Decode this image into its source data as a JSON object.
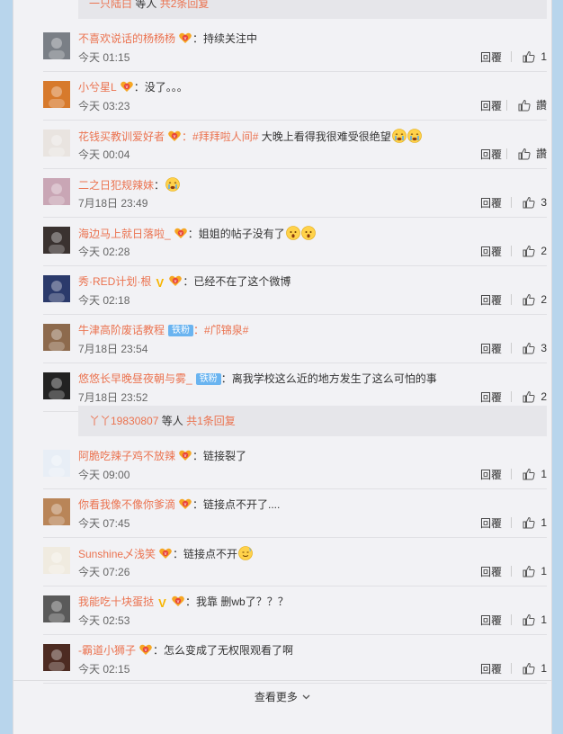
{
  "top_sub_bar": {
    "user": "一只陆白",
    "mid": " 等人 ",
    "count": "共2条回复"
  },
  "mid_sub_bar": {
    "user": "丫丫19830807",
    "mid": " 等人 ",
    "count": "共1条回复"
  },
  "reply_label": "回覆",
  "comments_group1": [
    {
      "user": "不喜欢说话的杨杨杨",
      "v": false,
      "tie": false,
      "text": "：持续关注中",
      "hashtag": "",
      "emoji": [],
      "time": "今天 01:15",
      "likes": "1"
    },
    {
      "user": "小兮星L",
      "v": false,
      "tie": false,
      "text": "：没了。。。",
      "hashtag": "",
      "emoji": [],
      "time": "今天 03:23",
      "likes": "讚"
    },
    {
      "user": "花钱买教训爱好者",
      "v": false,
      "tie": false,
      "text": " 大晚上看得我很难受很绝望",
      "hashtag": "：#拜拜啦人间#",
      "emoji": [
        "cry",
        "cry"
      ],
      "time": "今天 00:04",
      "likes": "讚"
    },
    {
      "user": "二之日犯规辣妹",
      "v": false,
      "tie": false,
      "text": "：",
      "hashtag": "",
      "emoji": [
        "cry"
      ],
      "time": "7月18日 23:49",
      "likes": "3",
      "nofan": true
    },
    {
      "user": "海边马上就日落啦_",
      "v": false,
      "tie": false,
      "text": "：姐姐的帖子没有了",
      "hashtag": "",
      "emoji": [
        "shock",
        "shock"
      ],
      "time": "今天 02:28",
      "likes": "2"
    },
    {
      "user": "秀·RED计划·根",
      "v": true,
      "tie": false,
      "text": "：已经不在了这个微博",
      "hashtag": "",
      "emoji": [],
      "time": "今天 02:18",
      "likes": "2"
    },
    {
      "user": "牛津高阶废话教程",
      "v": false,
      "tie": true,
      "text": "",
      "hashtag": "：#邝锦泉#",
      "emoji": [],
      "time": "7月18日 23:54",
      "likes": "3",
      "nofan": true
    },
    {
      "user": "悠悠长早晚昼夜朝与雾_",
      "v": false,
      "tie": true,
      "text": "：离我学校这么近的地方发生了这么可怕的事",
      "hashtag": "",
      "emoji": [],
      "time": "7月18日 23:52",
      "likes": "2",
      "nofan": true
    }
  ],
  "comments_group2": [
    {
      "user": "阿脆吃辣子鸡不放辣",
      "v": false,
      "tie": false,
      "text": "：链接裂了",
      "hashtag": "",
      "emoji": [],
      "time": "今天 09:00",
      "likes": "1"
    },
    {
      "user": "你看我像不像你爹滴",
      "v": false,
      "tie": false,
      "text": "：链接点不开了....",
      "hashtag": "",
      "emoji": [],
      "time": "今天 07:45",
      "likes": "1"
    },
    {
      "user": "Sunshine乄浅笑",
      "v": false,
      "tie": false,
      "text": "：链接点不开",
      "hashtag": "",
      "emoji": [
        "sweat"
      ],
      "time": "今天 07:26",
      "likes": "1"
    },
    {
      "user": "我能吃十块蛋挞",
      "v": true,
      "tie": false,
      "text": "：我靠 删wb了？？？",
      "hashtag": "",
      "emoji": [],
      "time": "今天 02:53",
      "likes": "1"
    },
    {
      "user": "-霸道小狮子",
      "v": false,
      "tie": false,
      "text": "：怎么变成了无权限观看了啊",
      "hashtag": "",
      "emoji": [],
      "time": "今天 02:15",
      "likes": "1"
    }
  ],
  "tie_label": "铁粉",
  "see_more": "查看更多",
  "avatar_colors": [
    "#7a7f86",
    "#d77a2c",
    "#e9e4e0",
    "#c9a6b5",
    "#3a3230",
    "#2b3a6b",
    "#8d6a4d",
    "#222222",
    "#e8eef6",
    "#b98558",
    "#f0ebe0",
    "#5a5a5a",
    "#4d2b22"
  ]
}
